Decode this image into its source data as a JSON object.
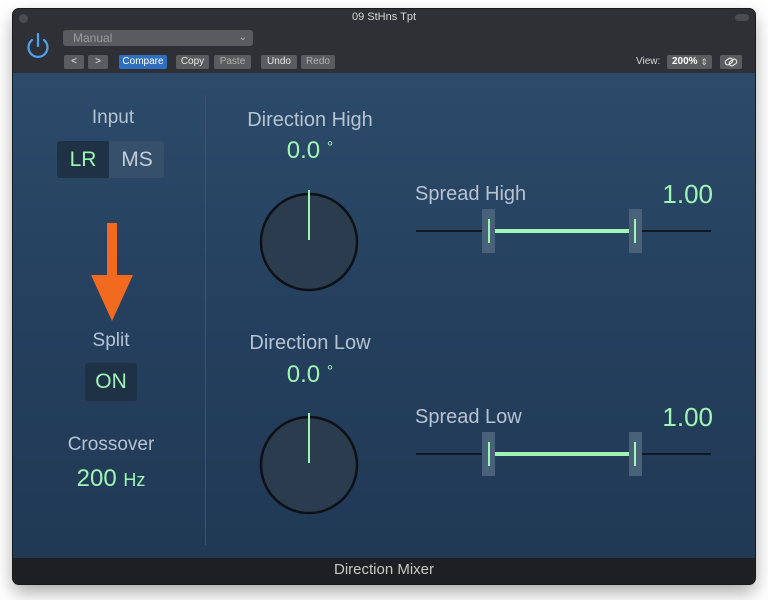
{
  "window": {
    "title": "09 StHns Tpt"
  },
  "toolbar": {
    "preset": "Manual",
    "prev_icon": "chevron-left-icon",
    "next_icon": "chevron-right-icon",
    "compare": "Compare",
    "copy": "Copy",
    "paste": "Paste",
    "undo": "Undo",
    "redo": "Redo",
    "view_label": "View:",
    "view_value": "200%",
    "link_icon": "link-icon"
  },
  "input": {
    "label": "Input",
    "lr": "LR",
    "ms": "MS",
    "selected": "LR"
  },
  "split": {
    "label": "Split",
    "value": "ON"
  },
  "crossover": {
    "label": "Crossover",
    "value": "200",
    "unit": "Hz"
  },
  "direction_high": {
    "label": "Direction High",
    "value": "0.0",
    "unit": "°",
    "angle_deg": 0
  },
  "direction_low": {
    "label": "Direction Low",
    "value": "0.0",
    "unit": "°",
    "angle_deg": 0
  },
  "spread_high": {
    "label": "Spread High",
    "value": "1.00",
    "level": 1.0
  },
  "spread_low": {
    "label": "Spread Low",
    "value": "1.00",
    "level": 1.0
  },
  "footer": {
    "plugin_name": "Direction Mixer"
  },
  "colors": {
    "accent_green": "#9ff5b3",
    "annotation_arrow": "#f26a1f",
    "compare_blue": "#2f6fbf"
  }
}
